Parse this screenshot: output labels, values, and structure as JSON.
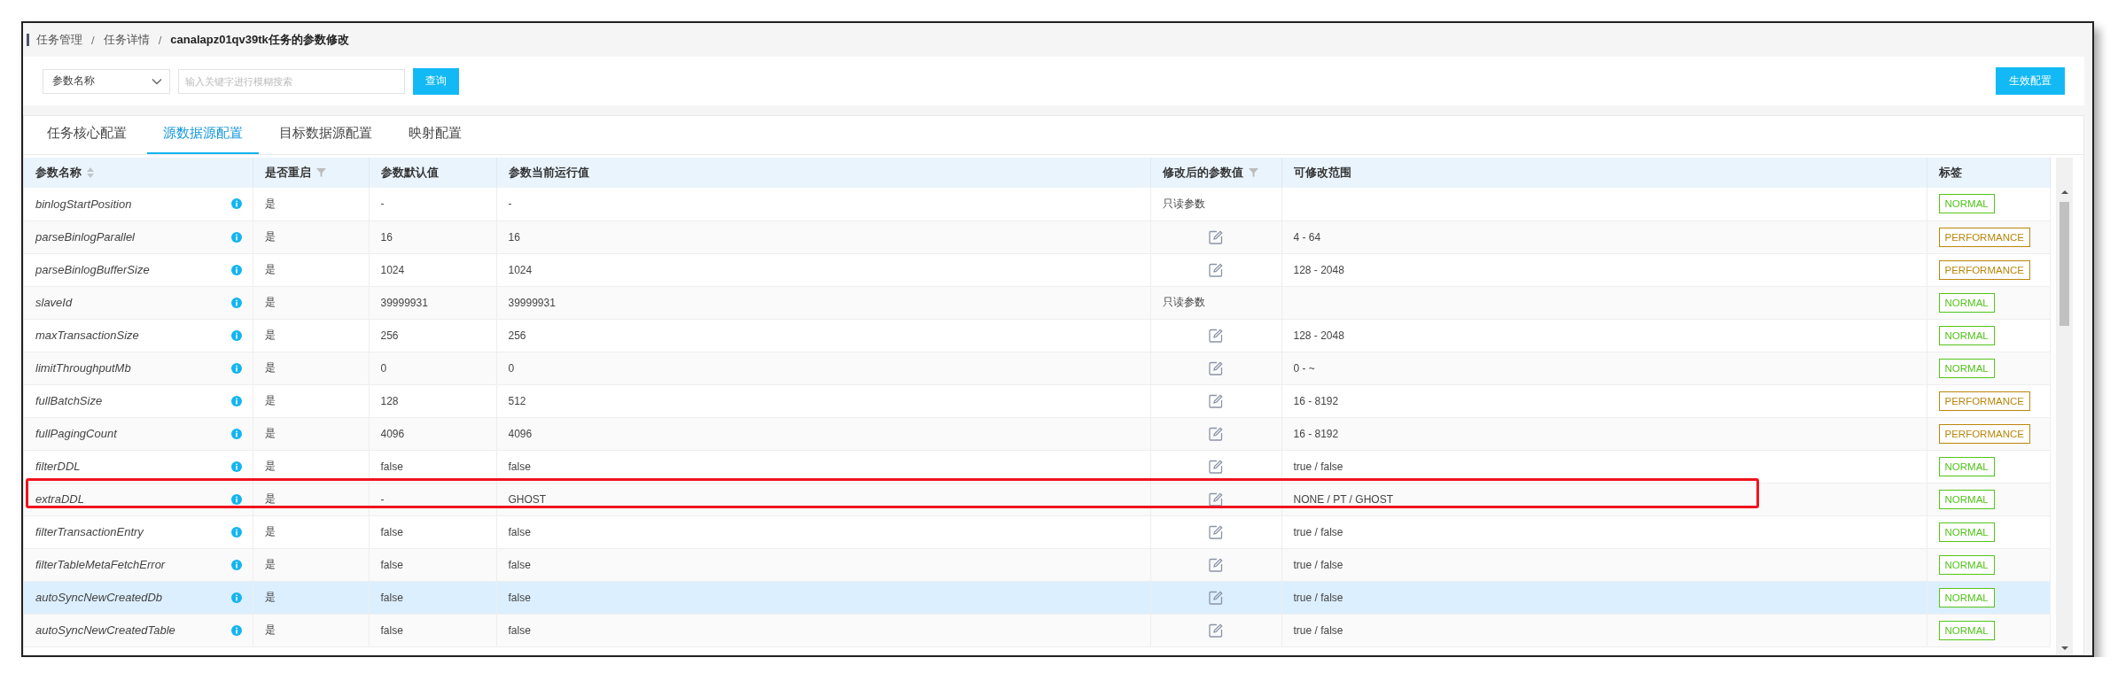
{
  "breadcrumb": [
    {
      "label": "任务管理"
    },
    {
      "separator": "/",
      "label": "任务详情"
    },
    {
      "separator": "/",
      "label": "canalapz01qv39tk任务的参数修改"
    }
  ],
  "filter": {
    "select": "参数名称",
    "placeholder": "输入关键字进行模糊搜索",
    "search_button": "查询",
    "apply_button": "生效配置"
  },
  "tabs": [
    {
      "label": "任务核心配置",
      "selected": false
    },
    {
      "label": "源数据源配置",
      "selected": true
    },
    {
      "label": "目标数据源配置",
      "selected": false
    },
    {
      "label": "映射配置",
      "selected": false
    }
  ],
  "table": {
    "columns": [
      {
        "label": "参数名称",
        "kind": "sort"
      },
      {
        "label": "是否重启",
        "kind": "filter"
      },
      {
        "label": "参数默认值",
        "kind": "plain"
      },
      {
        "label": "参数当前运行值",
        "kind": "plain"
      },
      {
        "label": "修改后的参数值",
        "kind": "filter"
      },
      {
        "label": "可修改范围",
        "kind": "plain"
      },
      {
        "label": "标签",
        "kind": "plain"
      }
    ],
    "rows": [
      {
        "name": "binlogStartPosition",
        "restart": "是",
        "default": "-",
        "current": "-",
        "modified": {
          "kind": "text",
          "text": "只读参数"
        },
        "range": "",
        "tag": "NORMAL",
        "color": "#52c41a",
        "hovered": false,
        "highlighted": false
      },
      {
        "name": "parseBinlogParallel",
        "restart": "是",
        "default": "16",
        "current": "16",
        "modified": {
          "kind": "edit"
        },
        "range": "4 - 64",
        "tag": "PERFORMANCE",
        "color": "#b8860b",
        "hovered": false,
        "highlighted": false
      },
      {
        "name": "parseBinlogBufferSize",
        "restart": "是",
        "default": "1024",
        "current": "1024",
        "modified": {
          "kind": "edit"
        },
        "range": "128 - 2048",
        "tag": "PERFORMANCE",
        "color": "#b8860b",
        "hovered": false,
        "highlighted": false
      },
      {
        "name": "slaveId",
        "restart": "是",
        "default": "39999931",
        "current": "39999931",
        "modified": {
          "kind": "text",
          "text": "只读参数"
        },
        "range": "",
        "tag": "NORMAL",
        "color": "#52c41a",
        "hovered": false,
        "highlighted": false
      },
      {
        "name": "maxTransactionSize",
        "restart": "是",
        "default": "256",
        "current": "256",
        "modified": {
          "kind": "edit"
        },
        "range": "128 - 2048",
        "tag": "NORMAL",
        "color": "#52c41a",
        "hovered": false,
        "highlighted": false
      },
      {
        "name": "limitThroughputMb",
        "restart": "是",
        "default": "0",
        "current": "0",
        "modified": {
          "kind": "edit"
        },
        "range": "0 - ~",
        "tag": "NORMAL",
        "color": "#52c41a",
        "hovered": false,
        "highlighted": false
      },
      {
        "name": "fullBatchSize",
        "restart": "是",
        "default": "128",
        "current": "512",
        "modified": {
          "kind": "edit"
        },
        "range": "16 - 8192",
        "tag": "PERFORMANCE",
        "color": "#b8860b",
        "hovered": false,
        "highlighted": false
      },
      {
        "name": "fullPagingCount",
        "restart": "是",
        "default": "4096",
        "current": "4096",
        "modified": {
          "kind": "edit"
        },
        "range": "16 - 8192",
        "tag": "PERFORMANCE",
        "color": "#b8860b",
        "hovered": false,
        "highlighted": false
      },
      {
        "name": "filterDDL",
        "restart": "是",
        "default": "false",
        "current": "false",
        "modified": {
          "kind": "edit"
        },
        "range": "true / false",
        "tag": "NORMAL",
        "color": "#52c41a",
        "hovered": false,
        "highlighted": false
      },
      {
        "name": "extraDDL",
        "restart": "是",
        "default": "-",
        "current": "GHOST",
        "modified": {
          "kind": "edit"
        },
        "range": "NONE / PT / GHOST",
        "tag": "NORMAL",
        "color": "#52c41a",
        "hovered": false,
        "highlighted": true
      },
      {
        "name": "filterTransactionEntry",
        "restart": "是",
        "default": "false",
        "current": "false",
        "modified": {
          "kind": "edit"
        },
        "range": "true / false",
        "tag": "NORMAL",
        "color": "#52c41a",
        "hovered": false,
        "highlighted": false
      },
      {
        "name": "filterTableMetaFetchError",
        "restart": "是",
        "default": "false",
        "current": "false",
        "modified": {
          "kind": "edit"
        },
        "range": "true / false",
        "tag": "NORMAL",
        "color": "#52c41a",
        "hovered": false,
        "highlighted": false
      },
      {
        "name": "autoSyncNewCreatedDb",
        "restart": "是",
        "default": "false",
        "current": "false",
        "modified": {
          "kind": "edit"
        },
        "range": "true / false",
        "tag": "NORMAL",
        "color": "#52c41a",
        "hovered": true,
        "highlighted": false
      },
      {
        "name": "autoSyncNewCreatedTable",
        "restart": "是",
        "default": "false",
        "current": "false",
        "modified": {
          "kind": "edit"
        },
        "range": "true / false",
        "tag": "NORMAL",
        "color": "#52c41a",
        "hovered": false,
        "highlighted": false
      }
    ]
  }
}
